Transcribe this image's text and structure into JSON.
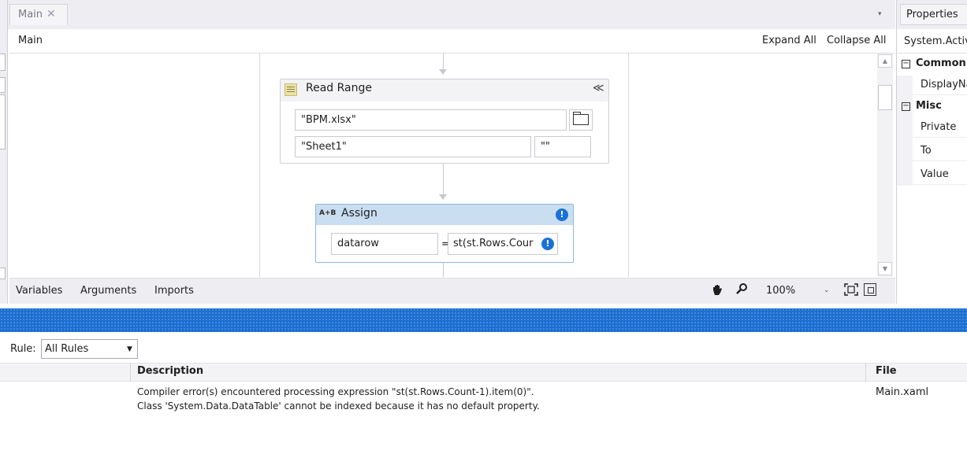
{
  "document_tab": {
    "label": "Main",
    "close": "✕"
  },
  "tab_overflow": "▾",
  "designer": {
    "breadcrumb": "Main",
    "expand_all": "Expand All",
    "collapse_all": "Collapse All"
  },
  "read_range": {
    "title": "Read Range",
    "collapse_glyph": "≪",
    "workbook_path": "\"BPM.xlsx\"",
    "sheet_name": "\"Sheet1\"",
    "range": "\"\""
  },
  "assign": {
    "icon_text": "A+B",
    "title": "Assign",
    "to": "datarow",
    "equals": "=",
    "value": "st(st.Rows.Cour",
    "warning_glyph": "!"
  },
  "scrollbar": {
    "up": "▲",
    "down": "▼"
  },
  "bottom_bar": {
    "variables": "Variables",
    "arguments": "Arguments",
    "imports": "Imports",
    "zoom": "100%",
    "zoom_dropdown": "⌄"
  },
  "properties": {
    "title": "Properties",
    "type_name": "System.Activ",
    "categories": [
      {
        "name": "Common",
        "expander": "−",
        "rows": [
          "DisplayNa"
        ]
      },
      {
        "name": "Misc",
        "expander": "−",
        "rows": [
          "Private",
          "To",
          "Value"
        ]
      }
    ]
  },
  "error_list": {
    "rule_label": "Rule:",
    "rule_value": "All Rules",
    "columns": {
      "description": "Description",
      "file": "File"
    },
    "errors": [
      {
        "line1": "Compiler error(s) encountered processing expression \"st(st.Rows.Count-1).item(0)\".",
        "line2": "Class 'System.Data.DataTable' cannot be indexed because it has no default property.",
        "file": "Main.xaml"
      }
    ]
  },
  "colors": {
    "accent_blue": "#1c6ed0",
    "assign_header": "#c9def0",
    "warning_blue": "#1c71d8"
  }
}
